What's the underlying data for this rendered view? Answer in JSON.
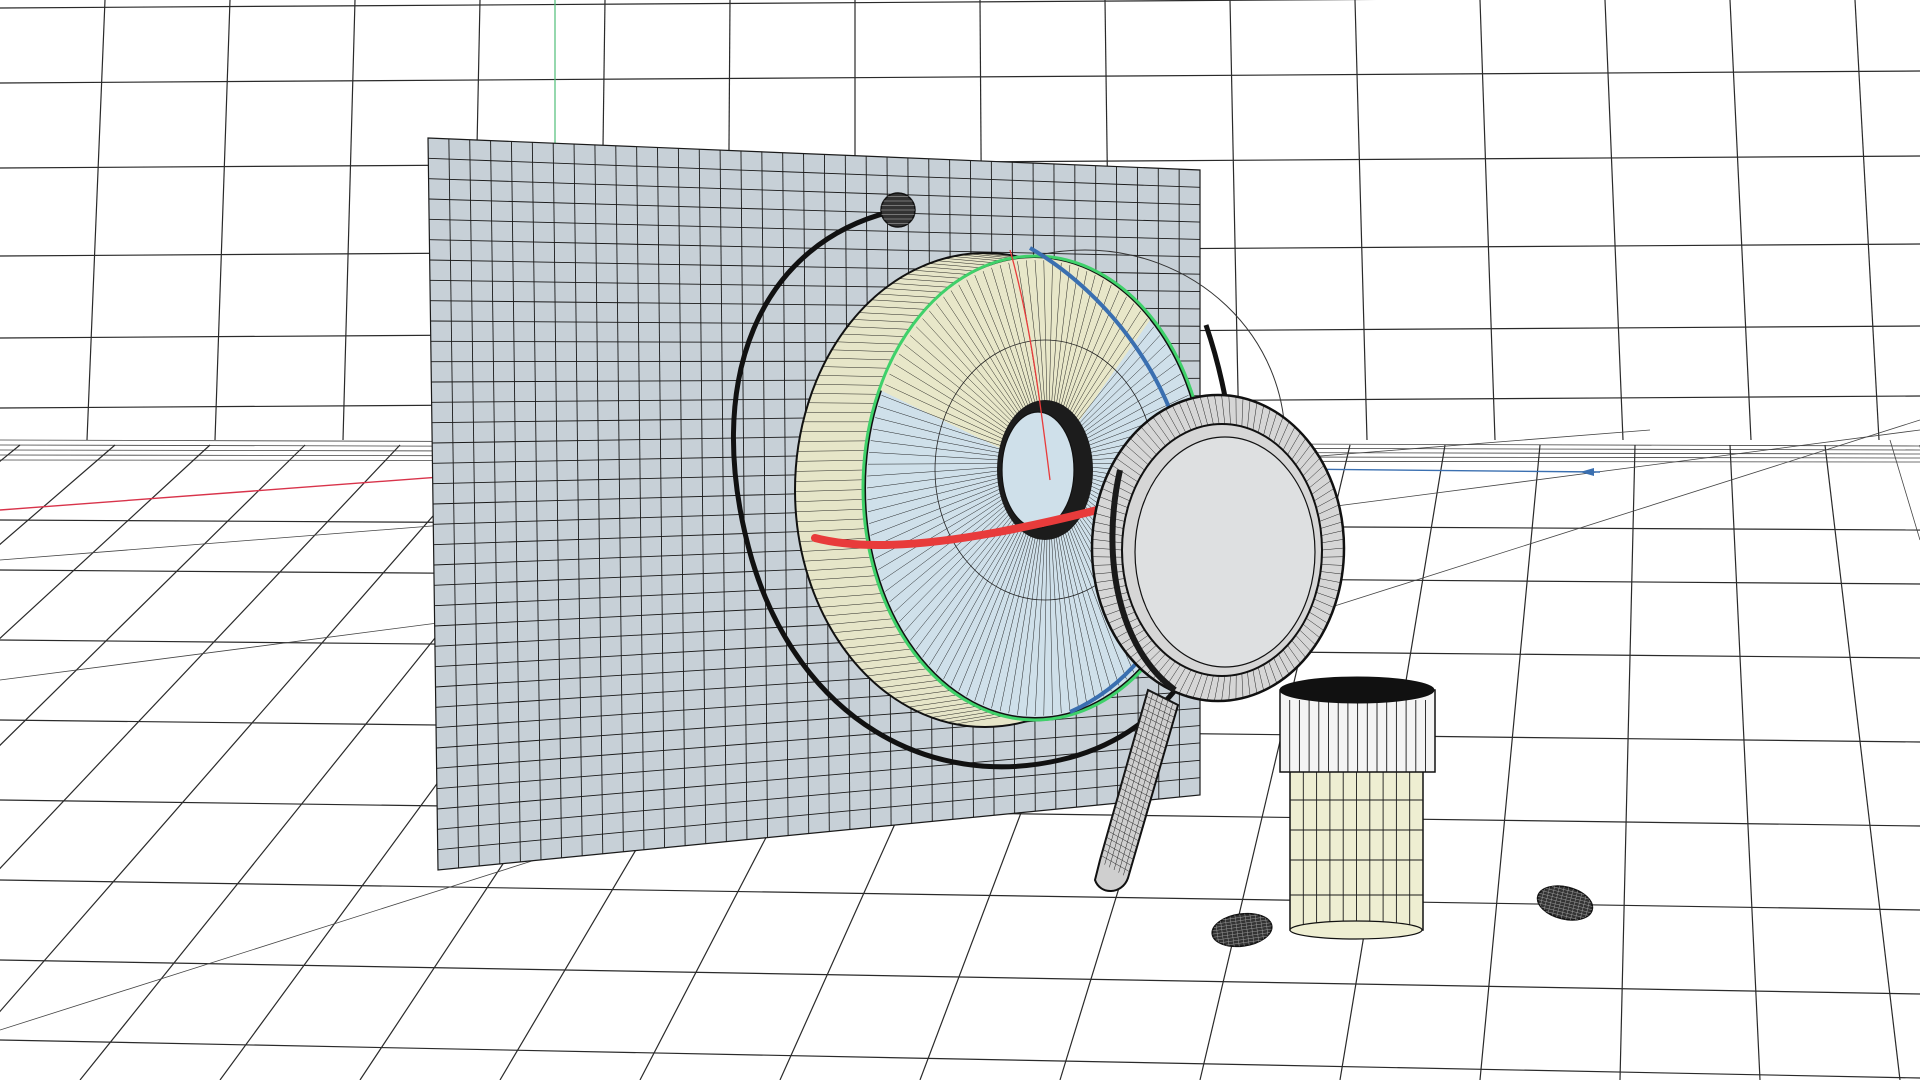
{
  "viewport": {
    "type": "3d-wireframe-viewport",
    "background": "#ffffff",
    "colors": {
      "background_plane": "#c7d0d7",
      "plane_grid": "#2b2f33",
      "lens_face": "#e8e7c9",
      "lens_body": "#cfe0ea",
      "torus": "#d6d6d6",
      "cap_light": "#eeeed2",
      "axis_red": "#e83b3b",
      "axis_green": "#3fd16a",
      "axis_blue": "#3a6fb0",
      "axis_red_far": "#d8334a",
      "axis_green_far": "#4fbf78"
    },
    "objects": [
      {
        "name": "vertical-grid-plane",
        "icon": "plane-icon"
      },
      {
        "name": "dish-lens",
        "icon": "dish-icon"
      },
      {
        "name": "magnifying-glass",
        "icon": "magnifier-icon"
      },
      {
        "name": "cylinder-container",
        "icon": "cylinder-icon"
      },
      {
        "name": "orbit-arc",
        "icon": "arc-icon"
      },
      {
        "name": "small-sphere",
        "icon": "sphere-icon"
      },
      {
        "name": "capsule-left",
        "icon": "capsule-icon"
      },
      {
        "name": "capsule-right",
        "icon": "capsule-icon"
      }
    ]
  }
}
